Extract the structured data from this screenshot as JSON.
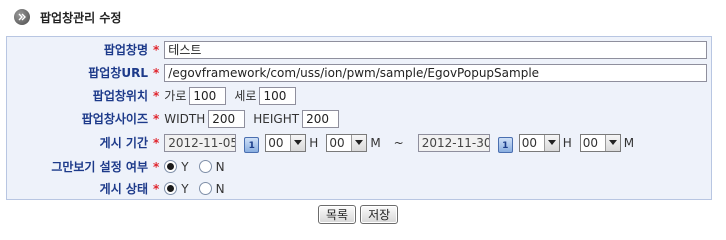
{
  "header": {
    "title": "팝업창관리 수정",
    "icon": "chevron-right-circle-icon"
  },
  "form": {
    "popup_name": {
      "label": "팝업창명",
      "value": "테스트"
    },
    "popup_url": {
      "label": "팝업창URL",
      "value": "/egovframework/com/uss/ion/pwm/sample/EgovPopupSample"
    },
    "popup_position": {
      "label": "팝업창위치",
      "horizontal_label": "가로",
      "horizontal_value": "100",
      "vertical_label": "세로",
      "vertical_value": "100"
    },
    "popup_size": {
      "label": "팝업창사이즈",
      "width_label": "WIDTH",
      "width_value": "200",
      "height_label": "HEIGHT",
      "height_value": "200"
    },
    "post_period": {
      "label": "게시 기간",
      "start_date": "2012-11-05",
      "start_hour": "00",
      "hour_unit": "H",
      "start_minute": "00",
      "minute_unit": "M",
      "separator": "~",
      "end_date": "2012-11-30",
      "end_hour": "00",
      "end_minute": "00",
      "calendar_icon_text": "1"
    },
    "stop_view": {
      "label": "그만보기 설정 여부",
      "options": [
        "Y",
        "N"
      ],
      "selected": "Y"
    },
    "post_status": {
      "label": "게시 상태",
      "options": [
        "Y",
        "N"
      ],
      "selected": "Y"
    },
    "required_mark": "*"
  },
  "buttons": {
    "list_label": "목록",
    "save_label": "저장"
  },
  "colors": {
    "label_text": "#1d3a8a",
    "required": "#e0262e",
    "form_bg": "#eef2fa",
    "form_border": "#b8c6e2"
  }
}
